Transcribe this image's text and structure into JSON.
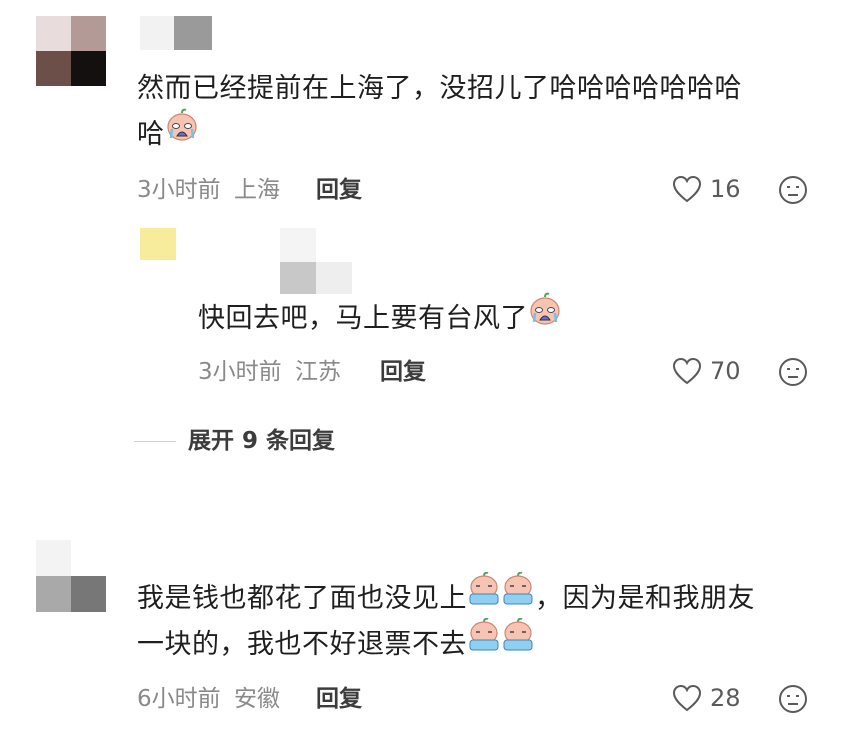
{
  "comments": [
    {
      "text_lines": [
        "然而已经提前在上海了，没招儿了哈哈哈哈哈哈哈",
        "哈"
      ],
      "time": "3小时前",
      "location": "上海",
      "reply_label": "回复",
      "likes": "16",
      "replies": [
        {
          "text": "快回去吧，马上要有台风了",
          "time": "3小时前",
          "location": "江苏",
          "reply_label": "回复",
          "likes": "70"
        }
      ],
      "expand_label": "展开 9 条回复"
    },
    {
      "text_lines": [
        "我是钱也都花了面也没见上",
        "，因为是和我朋友",
        "一块的，我也不好退票不去"
      ],
      "time": "6小时前",
      "location": "安徽",
      "reply_label": "回复",
      "likes": "28"
    }
  ],
  "icons": {
    "like": "heart-outline-icon",
    "dislike": "frown-face-icon",
    "emoji_crying": "crying-emoji",
    "emoji_water": "tears-emoji"
  },
  "colors": {
    "text": "#1f1f1f",
    "meta": "#8a8a8a",
    "icon": "#5a5a5a"
  }
}
